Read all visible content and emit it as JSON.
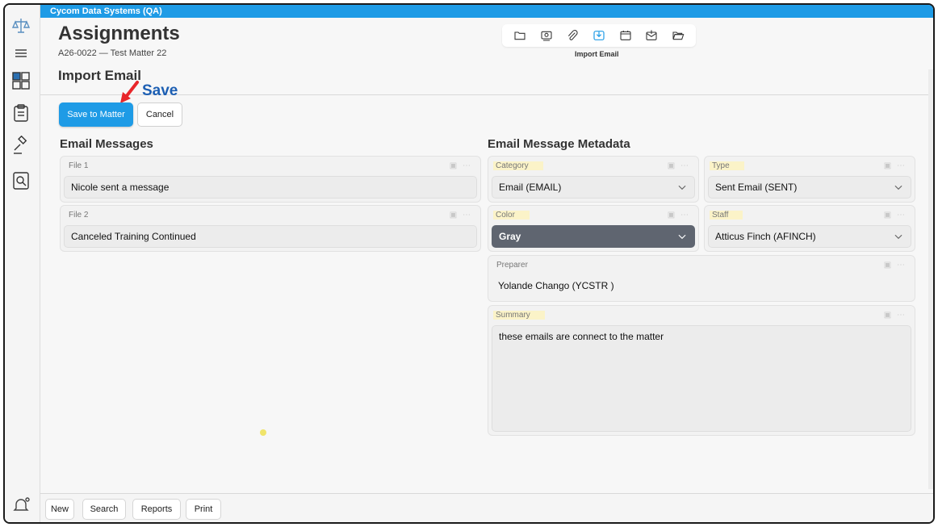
{
  "app": {
    "window_title": "Cycom Data Systems (QA)"
  },
  "header": {
    "title": "Assignments",
    "subtitle": "A26-0022 — Test Matter 22",
    "section": "Import Email",
    "annotation": "Save",
    "toolbar_label": "Import Email",
    "toolbar_icons": [
      "folder-icon",
      "camera-icon",
      "paperclip-icon",
      "import-email-icon",
      "calendar-icon",
      "export-mail-icon",
      "folder-open-icon"
    ]
  },
  "actions": {
    "save_label": "Save to Matter",
    "cancel_label": "Cancel"
  },
  "email_messages": {
    "title": "Email Messages",
    "files": [
      {
        "label": "File 1",
        "value": "Nicole sent a message"
      },
      {
        "label": "File 2",
        "value": "Canceled Training Continued"
      }
    ]
  },
  "metadata": {
    "title": "Email Message Metadata",
    "category": {
      "label": "Category",
      "value": "Email (EMAIL)"
    },
    "type": {
      "label": "Type",
      "value": "Sent Email (SENT)"
    },
    "color": {
      "label": "Color",
      "value": "Gray",
      "swatch": "#5f6570"
    },
    "staff": {
      "label": "Staff",
      "value": "Atticus Finch (AFINCH)"
    },
    "preparer": {
      "label": "Preparer",
      "value": "Yolande Chango (YCSTR )"
    },
    "summary": {
      "label": "Summary",
      "value": "these emails are connect to the matter"
    }
  },
  "footer": {
    "new_label": "New",
    "search_label": "Search",
    "reports_label": "Reports",
    "print_label": "Print"
  },
  "colors": {
    "accent": "#1e9be6",
    "annotation": "#1d5fb3",
    "arrow": "#e8262a",
    "highlight": "#fbf3c8"
  }
}
